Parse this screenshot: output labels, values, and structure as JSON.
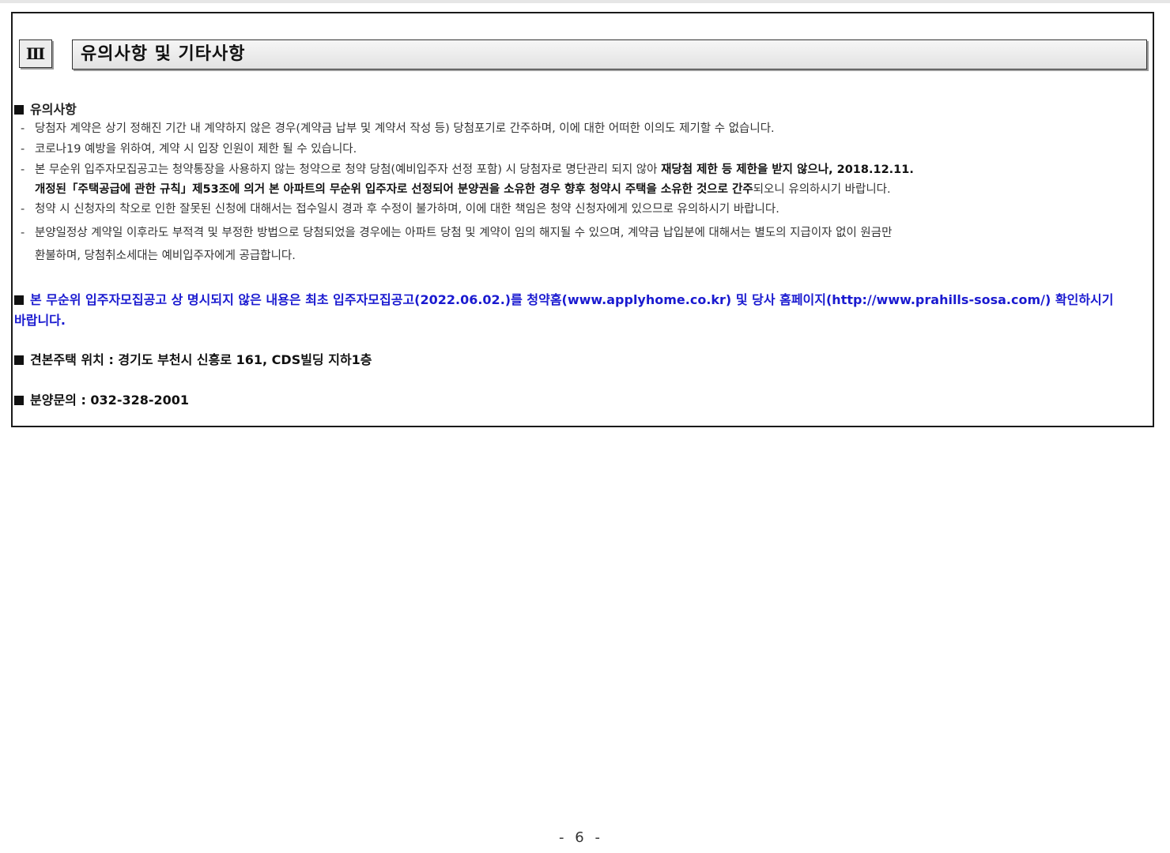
{
  "section": {
    "number": "Ⅲ",
    "title": "유의사항 및 기타사항"
  },
  "notes": {
    "heading": "유의사항",
    "items": [
      "당첨자 계약은 상기 정해진 기간 내 계약하지 않은 경우(계약금 납부 및 계약서 작성 등) 당첨포기로 간주하며, 이에 대한 어떠한 이의도 제기할 수 없습니다.",
      "코로나19 예방을 위하여, 계약 시 입장 인원이 제한 될 수 있습니다.",
      "본 무순위 입주자모집공고는 청약통장을 사용하지 않는 청약으로 청약 당첨(예비입주자 선정 포함) 시 당첨자로 명단관리 되지 않아 ",
      "청약 시 신청자의 착오로 인한 잘못된 신청에 대해서는 접수일시 경과 후 수정이 불가하며, 이에 대한 책임은 청약 신청자에게 있으므로 유의하시기 바랍니다.",
      "분양일정상 계약일 이후라도 부적격 및 부정한 방법으로 당첨되었을 경우에는 아파트 당첨 및 계약이 임의 해지될 수 있으며, 계약금 납입분에 대해서는 별도의 지급이자 없이 원금만"
    ],
    "item3_bold_a": "재당첨 제한 등 제한을 받지 않으나, 2018.12.11.",
    "item3_bold_b": "개정된「주택공급에 관한 규칙」제53조에 의거 본 아파트의 무순위 입주자로 선정되어 분양권을 소유한 경우 향후 청약시 주택을 소유한 것으로 간주",
    "item3_tail": "되오니 유의하시기 바랍니다.",
    "item5_cont": "환불하며, 당첨취소세대는 예비입주자에게 공급합니다."
  },
  "notice": {
    "line1": "본 무순위 입주자모집공고 상 명시되지 않은 내용은 최초 입주자모집공고(2022.06.02.)를 청약홈(www.applyhome.co.kr) 및 당사 홈페이지(http://www.prahills-sosa.com/) 확인하시기",
    "line2": "바랍니다."
  },
  "model_house": {
    "text": "견본주택 위치 : 경기도 부천시 신흥로 161, CDS빌딩 지하1층"
  },
  "inquiry": {
    "text": "분양문의 : 032-328-2001"
  },
  "footer": {
    "page": "- 6 -"
  },
  "colors": {
    "notice_blue": "#1a1ad0"
  }
}
